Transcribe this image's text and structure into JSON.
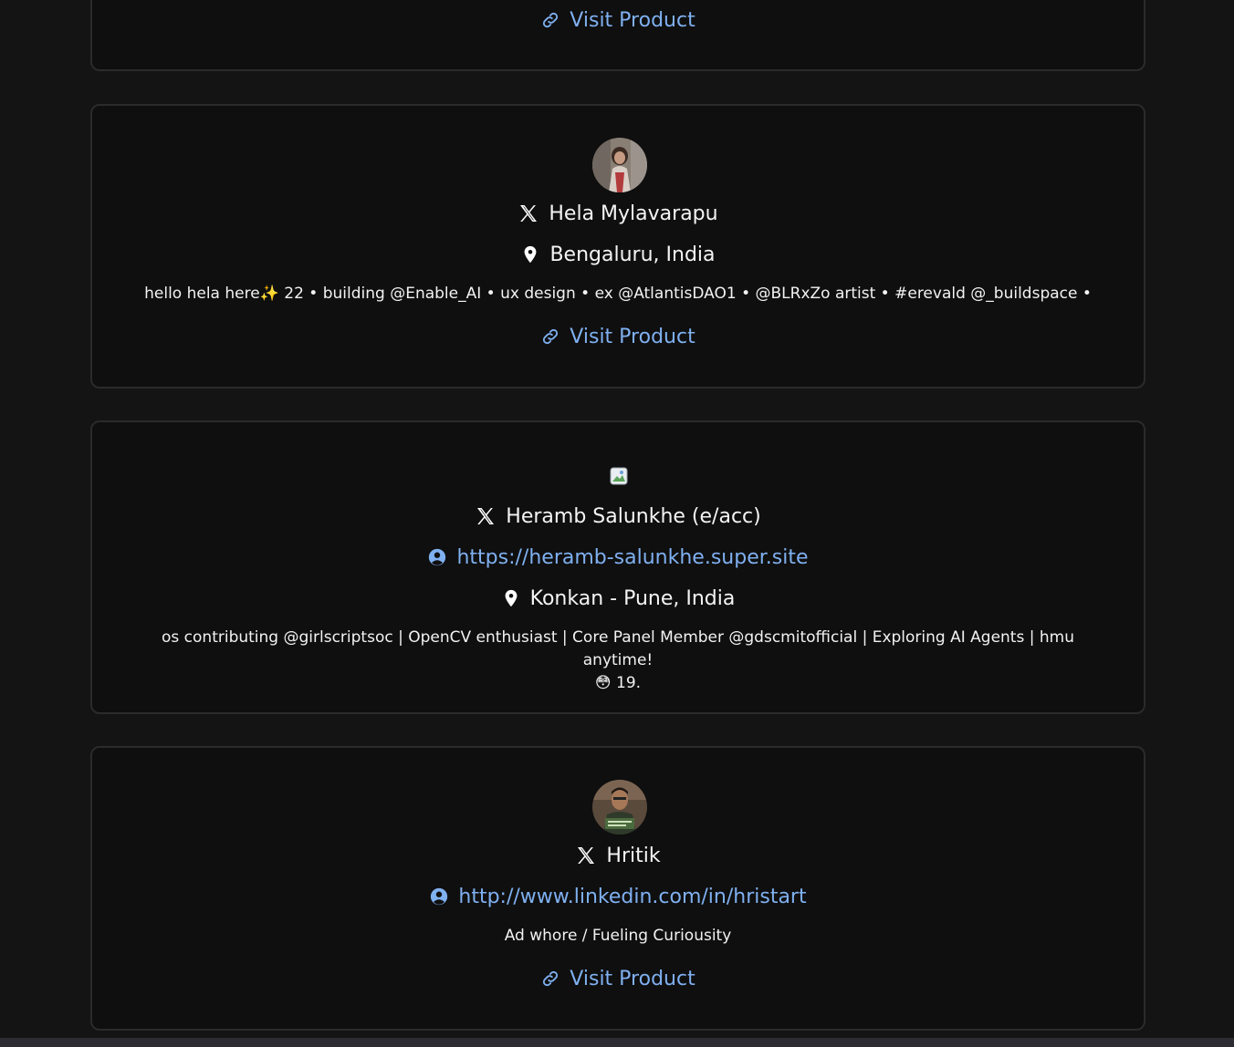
{
  "colors": {
    "background": "#141414",
    "card_background": "#0f0f0f",
    "card_border": "#2b2b2b",
    "link": "#7fb0f0",
    "text": "#f2f2f2"
  },
  "cards": [
    {
      "visit_label": "Visit Product"
    },
    {
      "name": "Hela Mylavarapu",
      "location": "Bengaluru, India",
      "bio": "hello hela here✨ 22 • building @Enable_AI • ux design • ex @AtlantisDAO1 • @BLRxZo artist • #erevald @_buildspace •",
      "visit_label": "Visit Product",
      "icons": [
        "x-logo-icon",
        "location-pin-icon",
        "link-icon"
      ]
    },
    {
      "name": "Heramb Salunkhe (e/acc)",
      "website": "https://heramb-salunkhe.super.site",
      "location": "Konkan - Pune, India",
      "bio_line1": "os contributing @girlscriptsoc | OpenCV enthusiast | Core Panel Member @gdscmitofficial | Exploring AI Agents | hmu anytime!",
      "bio_line2": "😳 19.",
      "icons": [
        "broken-image-icon",
        "x-logo-icon",
        "user-circle-icon",
        "location-pin-icon"
      ]
    },
    {
      "name": "Hritik",
      "website": "http://www.linkedin.com/in/hristart",
      "bio": "Ad whore / Fueling Curiousity",
      "visit_label": "Visit Product",
      "icons": [
        "x-logo-icon",
        "user-circle-icon",
        "link-icon"
      ]
    }
  ]
}
